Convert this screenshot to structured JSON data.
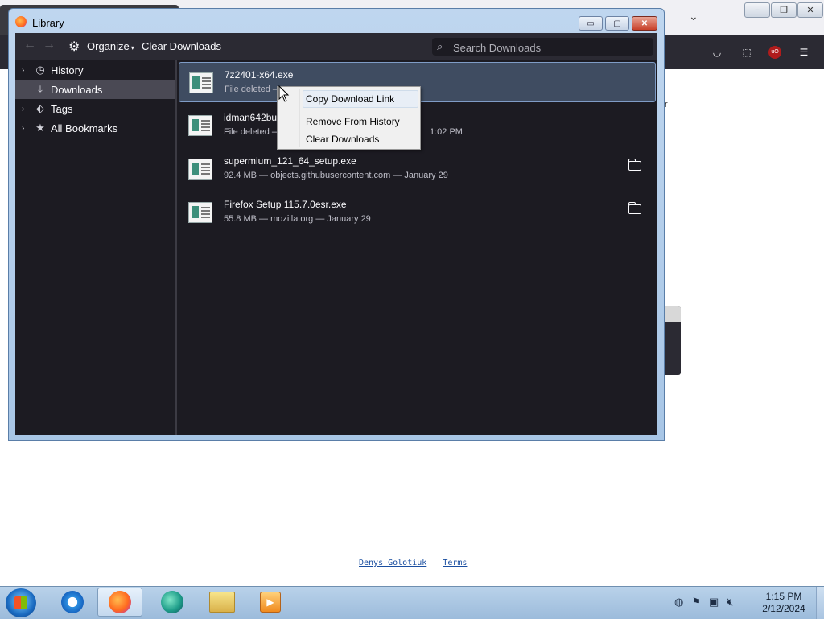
{
  "window": {
    "title": "Library",
    "buttons": {
      "minimize": "▭",
      "maximize": "▢",
      "close": "✕"
    }
  },
  "toolbar": {
    "back": "←",
    "forward": "→",
    "organize_label": "Organize",
    "clear_label": "Clear Downloads",
    "search_placeholder": "Search Downloads"
  },
  "sidebar": {
    "items": [
      {
        "label": "History",
        "icon": "clock-icon",
        "twisty": "›"
      },
      {
        "label": "Downloads",
        "icon": "download-icon",
        "twisty": ""
      },
      {
        "label": "Tags",
        "icon": "tag-icon",
        "twisty": "›"
      },
      {
        "label": "All Bookmarks",
        "icon": "star-icon",
        "twisty": "›"
      }
    ]
  },
  "downloads": [
    {
      "name": "7z2401-x64.exe",
      "meta": "File deleted —",
      "folder": false,
      "selected": true
    },
    {
      "name": "idman642bu",
      "meta": "File deleted —",
      "time": "1:02 PM",
      "folder": false,
      "selected": false
    },
    {
      "name": "supermium_121_64_setup.exe",
      "meta": "92.4 MB — objects.githubusercontent.com — January 29",
      "folder": true,
      "selected": false
    },
    {
      "name": "Firefox Setup 115.7.0esr.exe",
      "meta": "55.8 MB — mozilla.org — January 29",
      "folder": true,
      "selected": false
    }
  ],
  "context_menu": {
    "items": [
      {
        "label": "Copy Download Link"
      },
      {
        "label": "Remove From History"
      },
      {
        "label": "Clear Downloads"
      }
    ]
  },
  "page": {
    "footer_links": [
      "Denys Golotiuk",
      "Terms"
    ]
  },
  "taskbar": {
    "clock_time": "1:15 PM",
    "clock_date": "2/12/2024",
    "apps": [
      "internet-explorer",
      "firefox",
      "globe-app",
      "file-explorer",
      "media-player"
    ]
  },
  "colors": {
    "library_bg": "#1c1b22",
    "toolbar_bg": "#2b2a33",
    "selected_row": "#3f4c61",
    "taskbar": "#b9d2ea"
  }
}
